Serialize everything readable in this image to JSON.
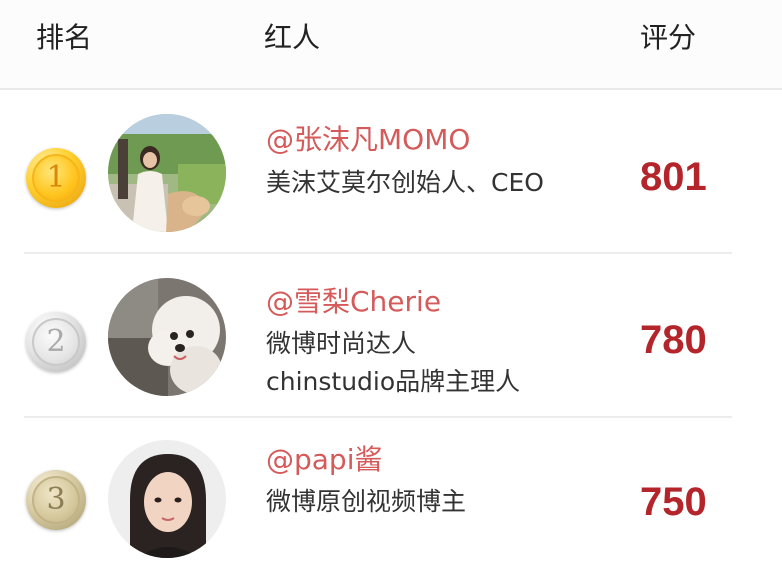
{
  "header": {
    "rank_label": "排名",
    "user_label": "红人",
    "score_label": "评分"
  },
  "colors": {
    "handle": "#d55a5a",
    "score": "#b3242b"
  },
  "rows": [
    {
      "rank": "1",
      "medal": "gold-medal-icon",
      "handle": "@张沫凡MOMO",
      "desc": [
        "美沫艾莫尔创始人、CEO"
      ],
      "score": "801"
    },
    {
      "rank": "2",
      "medal": "silver-medal-icon",
      "handle": "@雪梨Cherie",
      "desc": [
        "微博时尚达人",
        "chinstudio品牌主理人"
      ],
      "score": "780"
    },
    {
      "rank": "3",
      "medal": "bronze-medal-icon",
      "handle": "@papi酱",
      "desc": [
        "微博原创视频博主"
      ],
      "score": "750"
    }
  ]
}
